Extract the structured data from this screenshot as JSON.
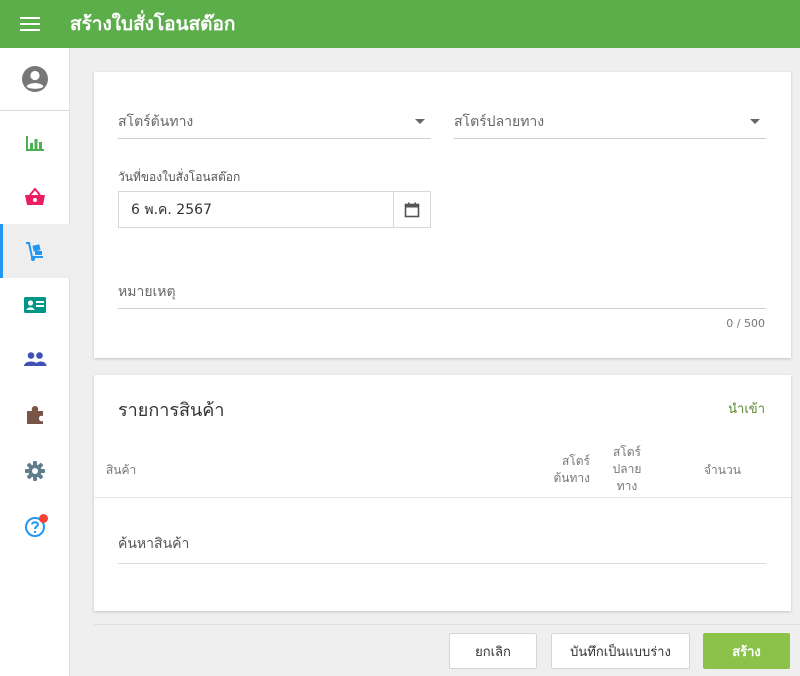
{
  "header": {
    "title": "สร้างใบสั่งโอนสต๊อก"
  },
  "icons": {
    "menu": "hamburger-icon",
    "account": "account-circle-icon",
    "reports": "bar-chart-icon",
    "sales": "basket-icon",
    "transfer": "dolly-icon",
    "customers": "contact-card-icon",
    "staff": "people-icon",
    "addons": "puzzle-icon",
    "settings": "gear-icon",
    "help": "help-circle-icon"
  },
  "colors": {
    "topbar": "#5cae4b",
    "primary_button": "#8bc34a",
    "active_indicator": "#2196f3",
    "notification_dot": "#f44336",
    "link": "#5a8a2d"
  },
  "form": {
    "source_store_label": "สโตร์ต้นทาง",
    "dest_store_label": "สโตร์ปลายทาง",
    "date_label": "วันที่ของใบสั่งโอนสต๊อก",
    "date_value": "6 พ.ค. 2567",
    "note_label": "หมายเหตุ",
    "note_counter": "0 / 500"
  },
  "items": {
    "title": "รายการสินค้า",
    "import_label": "นำเข้า",
    "columns": {
      "product": "สินค้า",
      "source_line1": "สโตร์",
      "source_line2": "ต้นทาง",
      "dest_line1": "สโตร์",
      "dest_line2": "ปลาย",
      "dest_line3": "ทาง",
      "quantity": "จำนวน"
    },
    "search_placeholder": "ค้นหาสินค้า"
  },
  "actions": {
    "cancel": "ยกเลิก",
    "save_draft": "บันทึกเป็นแบบร่าง",
    "create": "สร้าง"
  }
}
